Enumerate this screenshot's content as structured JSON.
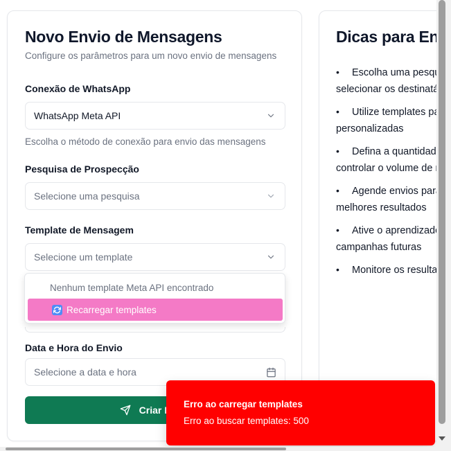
{
  "form": {
    "title": "Novo Envio de Mensagens",
    "subtitle": "Configure os parâmetros para um novo envio de mensagens",
    "connection": {
      "label": "Conexão de WhatsApp",
      "value": "WhatsApp Meta API",
      "helper": "Escolha o método de conexão para envio das mensagens"
    },
    "survey": {
      "label": "Pesquisa de Prospecção",
      "placeholder": "Selecione uma pesquisa"
    },
    "template": {
      "label": "Template de Mensagem",
      "placeholder": "Selecione um template",
      "dropdown": {
        "empty_text": "Nenhum template Meta API encontrado",
        "reload_label": "Recarregar templates",
        "reload_icon": "refresh-icon"
      }
    },
    "datetime": {
      "label": "Data e Hora do Envio",
      "placeholder": "Selecione a data e hora",
      "icon": "calendar-icon"
    },
    "submit": {
      "label": "Criar Envio",
      "icon": "send-icon",
      "color": "#0f7a53"
    }
  },
  "tips": {
    "title": "Dicas para Envio",
    "items": [
      {
        "line1": "Escolha uma pesquisa para",
        "line2": "selecionar os destinatários"
      },
      {
        "line1": "Utilize templates para mensagens",
        "line2": "personalizadas"
      },
      {
        "line1": "Defina a quantidade de envios para",
        "line2": "controlar o volume de mensagens"
      },
      {
        "line1": "Agende envios para horários com",
        "line2": "melhores resultados"
      },
      {
        "line1": "Ative o aprendizado para otimizar",
        "line2": "campanhas futuras"
      },
      {
        "line1": "Monitore os resultados",
        "line2": ""
      }
    ]
  },
  "toast": {
    "title": "Erro ao carregar templates",
    "description": "Erro ao buscar templates: 500",
    "color": "#ff0000"
  },
  "colors": {
    "accent_pink": "#f47ac6",
    "primary_green": "#0f7a53",
    "error_red": "#ff0000"
  }
}
